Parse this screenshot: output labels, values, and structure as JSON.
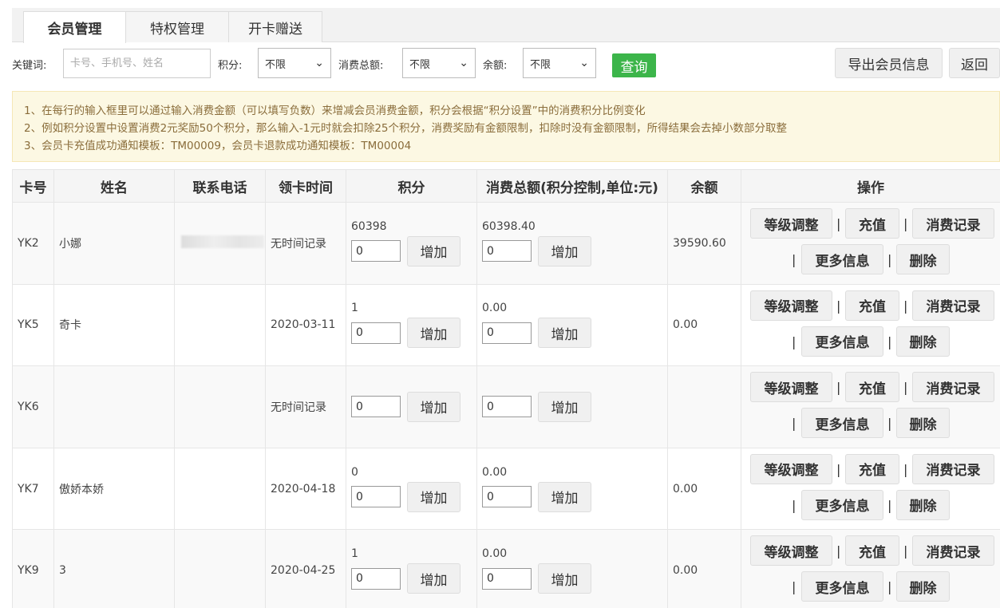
{
  "tabs": [
    {
      "label": "会员管理",
      "active": true
    },
    {
      "label": "特权管理",
      "active": false
    },
    {
      "label": "开卡赠送",
      "active": false
    }
  ],
  "filter": {
    "keyword_label": "关键词:",
    "keyword_placeholder": "卡号、手机号、姓名",
    "points_label": "积分:",
    "points_value": "不限",
    "total_label": "消费总额:",
    "total_value": "不限",
    "balance_label": "余额:",
    "balance_value": "不限",
    "query_label": "查询",
    "export_label": "导出会员信息",
    "back_label": "返回"
  },
  "notice": [
    "1、在每行的输入框里可以通过输入消费金额（可以填写负数）来增减会员消费金额，积分会根据“积分设置”中的消费积分比例变化",
    "2、例如积分设置中设置消费2元奖励50个积分，那么输入-1元时就会扣除25个积分，消费奖励有金额限制，扣除时没有金额限制，所得结果会去掉小数部分取整",
    "3、会员卡充值成功通知模板：TM00009，会员卡退款成功通知模板：TM00004"
  ],
  "table": {
    "headers": [
      "卡号",
      "姓名",
      "联系电话",
      "领卡时间",
      "积分",
      "消费总额(积分控制,单位:元)",
      "余额",
      "操作"
    ],
    "rows": [
      {
        "card": "YK2",
        "name": "小娜",
        "phone_blurred": true,
        "time": "无时间记录",
        "points": "60398",
        "points_input": "0",
        "total": "60398.40",
        "total_input": "0",
        "balance": "39590.60"
      },
      {
        "card": "YK5",
        "name": "奇卡",
        "phone_blurred": false,
        "time": "2020-03-11",
        "points": "1",
        "points_input": "0",
        "total": "0.00",
        "total_input": "0",
        "balance": "0.00"
      },
      {
        "card": "YK6",
        "name": "",
        "phone_blurred": false,
        "time": "无时间记录",
        "points": "",
        "points_input": "0",
        "total": "",
        "total_input": "0",
        "balance": ""
      },
      {
        "card": "YK7",
        "name": "傲娇本娇",
        "phone_blurred": false,
        "time": "2020-04-18",
        "points": "0",
        "points_input": "0",
        "total": "0.00",
        "total_input": "0",
        "balance": "0.00"
      },
      {
        "card": "YK9",
        "name": "3",
        "phone_blurred": false,
        "time": "2020-04-25",
        "points": "1",
        "points_input": "0",
        "total": "0.00",
        "total_input": "0",
        "balance": "0.00"
      }
    ],
    "add_label": "增加",
    "ops": {
      "level": "等级调整",
      "recharge": "充值",
      "records": "消费记录",
      "more": "更多信息",
      "delete": "删除",
      "separator": "|"
    }
  },
  "colors": {
    "accent_green": "#3cb54a",
    "notice_bg": "#fcf8e3",
    "notice_text": "#8a6d3b"
  }
}
